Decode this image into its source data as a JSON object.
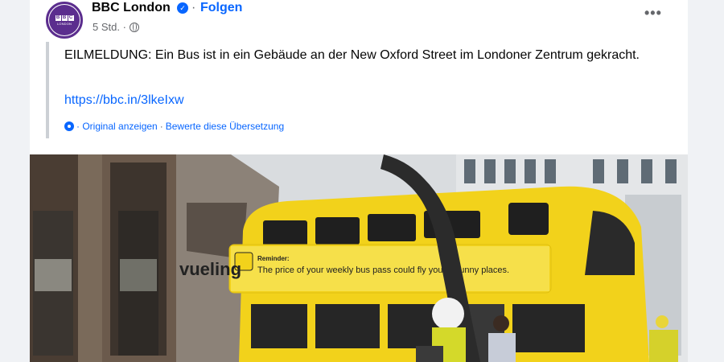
{
  "post": {
    "page_name": "BBC London",
    "follow_label": "Folgen",
    "dot": "·",
    "time": "5 Std. ·",
    "more_label": "•••",
    "text": "EILMELDUNG: Ein Bus ist in ein Gebäude an der New Oxford Street im Londoner Zentrum gekracht.",
    "link": "https://bbc.in/3lkeIxw",
    "translate_original": "· Original anzeigen",
    "translate_sep": "·",
    "translate_rate": "Bewerte diese Übersetzung"
  },
  "avatar": {
    "logo_letters": [
      "B",
      "B",
      "C"
    ],
    "logo_sub": "LONDON"
  },
  "photo": {
    "ad_brand": "vueling",
    "ad_title": "Reminder:",
    "ad_text": "The price of your weekly bus pass could fly you to sunny places."
  },
  "colors": {
    "accent": "#0866ff",
    "bus_yellow": "#f2d21b",
    "bbc_purple": "#5b2d8e"
  },
  "icons": [
    "verified-badge-icon",
    "globe-icon",
    "more-options-icon",
    "translate-gear-icon"
  ]
}
